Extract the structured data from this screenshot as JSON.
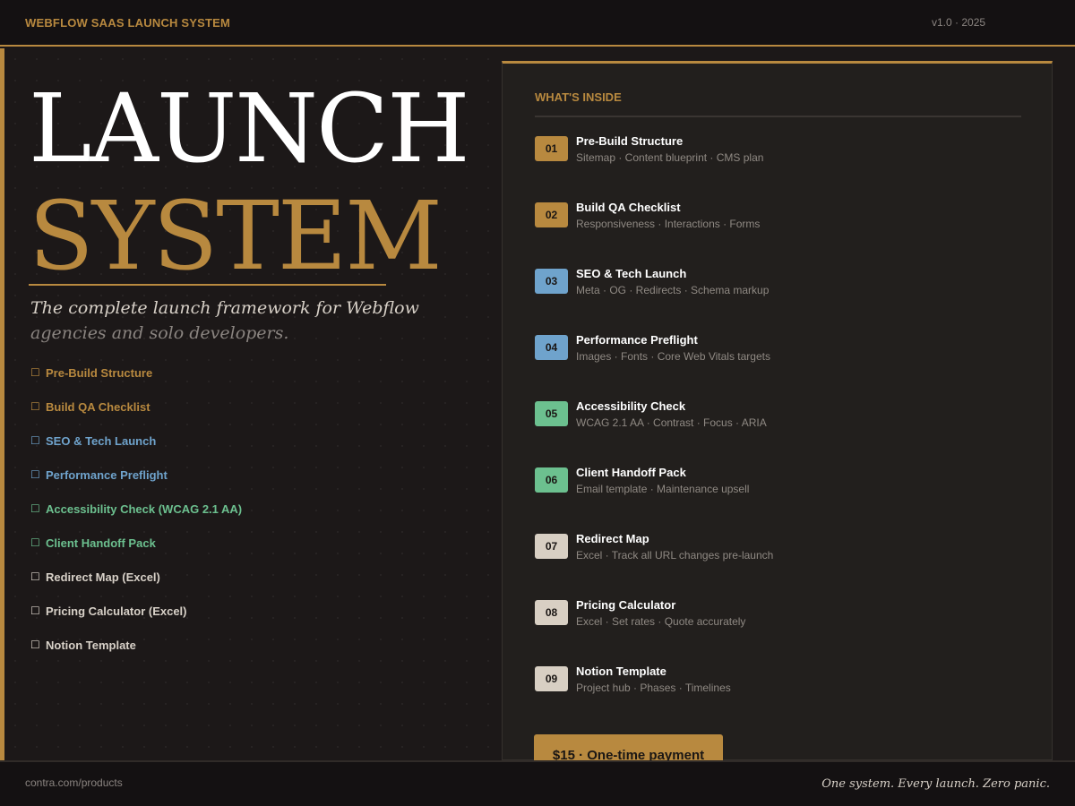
{
  "header": {
    "brand": "WEBFLOW SAAS LAUNCH SYSTEM",
    "version": "v1.0 · 2025"
  },
  "hero": {
    "line1": "LAUNCH",
    "line2": "SYSTEM",
    "tagline_line1": "The complete launch framework for Webflow",
    "tagline_line2": "agencies and solo developers."
  },
  "features": [
    {
      "check_icon": "checkbox-icon",
      "glyph": "☐",
      "label": "Pre-Build Structure",
      "color": "#b8893f"
    },
    {
      "check_icon": "checkbox-icon",
      "glyph": "☐",
      "label": "Build QA Checklist",
      "color": "#b8893f"
    },
    {
      "check_icon": "checkbox-icon",
      "glyph": "☐",
      "label": "SEO & Tech Launch",
      "color": "#6fa3cc"
    },
    {
      "check_icon": "checkbox-icon",
      "glyph": "☐",
      "label": "Performance Preflight",
      "color": "#6fa3cc"
    },
    {
      "check_icon": "checkbox-icon",
      "glyph": "☐",
      "label": "Accessibility Check (WCAG 2.1 AA)",
      "color": "#6cc08f"
    },
    {
      "check_icon": "checkbox-icon",
      "glyph": "☐",
      "label": "Client Handoff Pack",
      "color": "#6cc08f"
    },
    {
      "check_icon": "checkbox-icon",
      "glyph": "☐",
      "label": "Redirect Map (Excel)",
      "color": "#d8d1c8"
    },
    {
      "check_icon": "checkbox-icon",
      "glyph": "☐",
      "label": "Pricing Calculator (Excel)",
      "color": "#d8d1c8"
    },
    {
      "check_icon": "checkbox-icon",
      "glyph": "☐",
      "label": "Notion Template",
      "color": "#d8d1c8"
    }
  ],
  "panel": {
    "title": "WHAT'S INSIDE",
    "items": [
      {
        "num": "01",
        "title": "Pre-Build Structure",
        "desc": "Sitemap · Content blueprint · CMS plan",
        "badge_color": "#b8893f"
      },
      {
        "num": "02",
        "title": "Build QA Checklist",
        "desc": "Responsiveness · Interactions · Forms",
        "badge_color": "#b8893f"
      },
      {
        "num": "03",
        "title": "SEO & Tech Launch",
        "desc": "Meta · OG · Redirects · Schema markup",
        "badge_color": "#6fa3cc"
      },
      {
        "num": "04",
        "title": "Performance Preflight",
        "desc": "Images · Fonts · Core Web Vitals targets",
        "badge_color": "#6fa3cc"
      },
      {
        "num": "05",
        "title": "Accessibility Check",
        "desc": "WCAG 2.1 AA · Contrast · Focus · ARIA",
        "badge_color": "#6cc08f"
      },
      {
        "num": "06",
        "title": "Client Handoff Pack",
        "desc": "Email template · Maintenance upsell",
        "badge_color": "#6cc08f"
      },
      {
        "num": "07",
        "title": "Redirect Map",
        "desc": "Excel · Track all URL changes pre-launch",
        "badge_color": "#d8cfc3"
      },
      {
        "num": "08",
        "title": "Pricing Calculator",
        "desc": "Excel · Set rates · Quote accurately",
        "badge_color": "#d8cfc3"
      },
      {
        "num": "09",
        "title": "Notion Template",
        "desc": "Project hub · Phases · Timelines",
        "badge_color": "#d8cfc3"
      }
    ]
  },
  "cta": {
    "label": "$15 · One-time payment"
  },
  "footer": {
    "url": "contra.com/products",
    "motto": "One system. Every launch. Zero panic."
  },
  "colors": {
    "accent": "#b8893f",
    "blue": "#6fa3cc",
    "green": "#6cc08f",
    "neutral": "#d8d1c8",
    "background": "#1c1818"
  }
}
